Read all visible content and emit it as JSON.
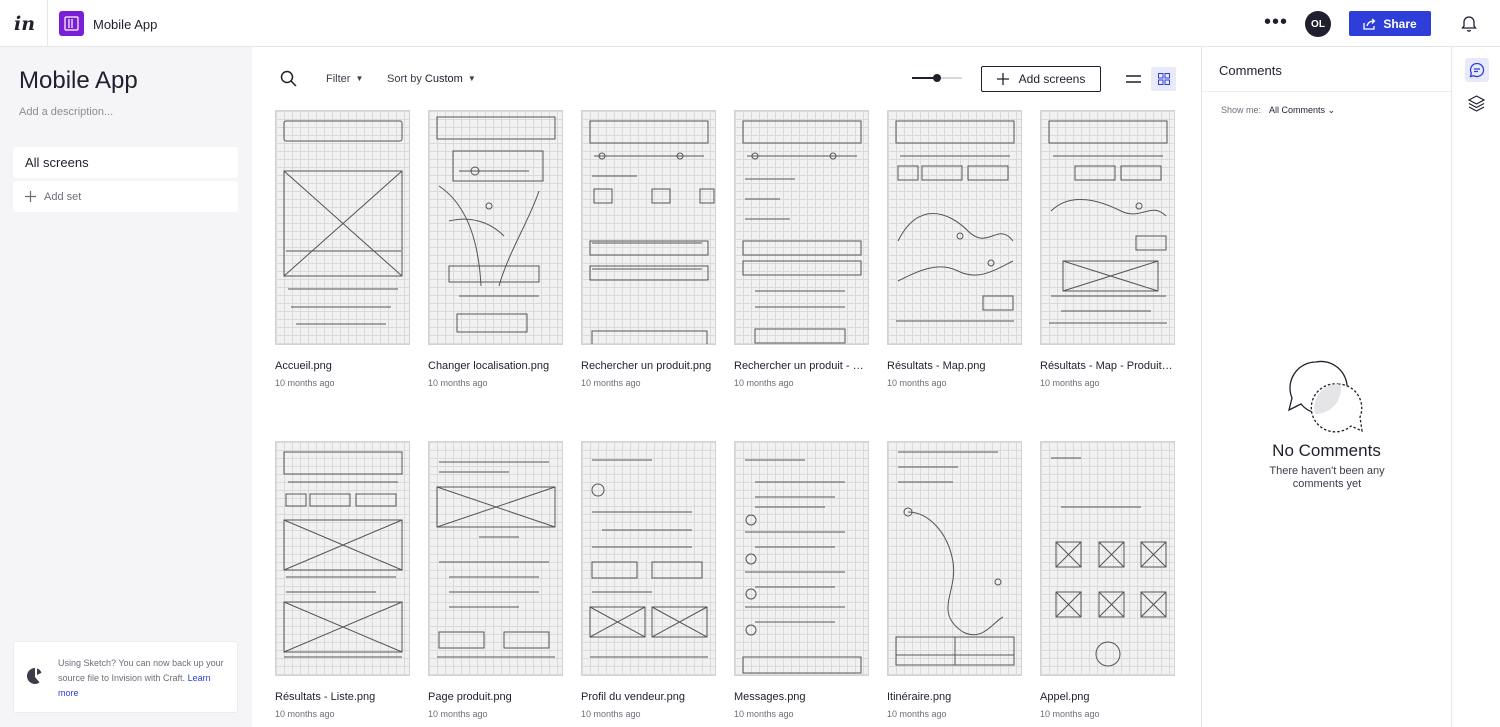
{
  "app": {
    "logo": "in",
    "project_title": "Mobile App",
    "avatar_initials": "OL",
    "share_label": "Share",
    "accent_color": "#2e3ed9",
    "project_badge_color": "#7b1fd6"
  },
  "sidebar": {
    "title": "Mobile App",
    "description_placeholder": "Add a description...",
    "all_screens_label": "All screens",
    "add_set_label": "Add set",
    "craft_notice": {
      "text": "Using Sketch? You can now back up your source file to Invision with Craft.",
      "link": "Learn more"
    }
  },
  "toolbar": {
    "filter_label": "Filter",
    "sort_prefix": "Sort by",
    "sort_value": "Custom",
    "add_screens_label": "Add screens",
    "thumbnail_size": 0.5
  },
  "screens": [
    {
      "name": "Accueil.png",
      "time": "10 months ago"
    },
    {
      "name": "Changer localisation.png",
      "time": "10 months ago"
    },
    {
      "name": "Rechercher un produit.png",
      "time": "10 months ago"
    },
    {
      "name": "Rechercher un produit - Courgette.png",
      "time": "10 months ago"
    },
    {
      "name": "Résultats - Map.png",
      "time": "10 months ago"
    },
    {
      "name": "Résultats - Map - Produit.png",
      "time": "10 months ago"
    },
    {
      "name": "Résultats - Liste.png",
      "time": "10 months ago"
    },
    {
      "name": "Page produit.png",
      "time": "10 months ago"
    },
    {
      "name": "Profil du vendeur.png",
      "time": "10 months ago"
    },
    {
      "name": "Messages.png",
      "time": "10 months ago"
    },
    {
      "name": "Itinéraire.png",
      "time": "10 months ago"
    },
    {
      "name": "Appel.png",
      "time": "10 months ago"
    }
  ],
  "comments": {
    "title": "Comments",
    "show_me_label": "Show me:",
    "filter_value": "All Comments",
    "empty_title": "No Comments",
    "empty_subtitle": "There haven't been any comments yet"
  }
}
